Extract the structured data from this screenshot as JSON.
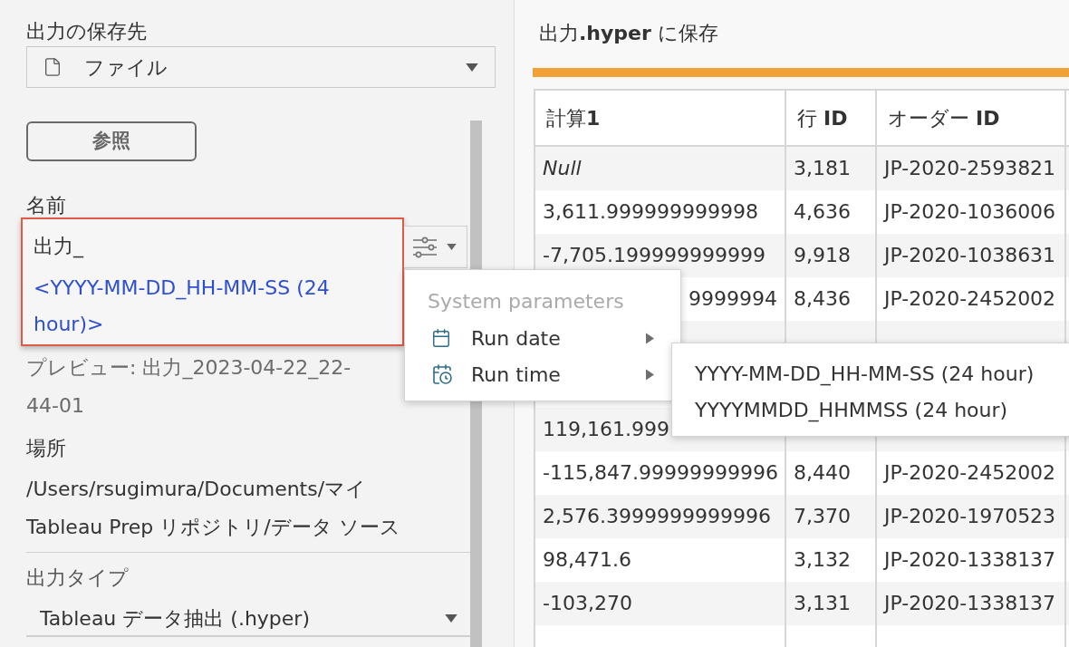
{
  "output_settings": {
    "destination_label": "出力の保存先",
    "destination": {
      "value": "ファイル"
    },
    "browse_button": "参照",
    "name_label": "名前",
    "name_field": {
      "text": "出力_",
      "token": "<YYYY-MM-DD_HH-MM-SS (24 hour)>",
      "highlighted": true
    },
    "preview": "プレビュー: 出力_2023-04-22_22-44-01",
    "location_label": "場所",
    "location": "/Users/rsugimura/Documents/マイ Tableau Prep リポジトリ/データ ソース",
    "output_type_label": "出力タイプ",
    "output_type": {
      "value": "Tableau データ抽出 (.hyper)"
    }
  },
  "parameter_menu": {
    "heading": "System parameters",
    "items": [
      {
        "label": "Run date",
        "kind": "date"
      },
      {
        "label": "Run time",
        "kind": "time"
      }
    ]
  },
  "run_time_submenu": {
    "items": [
      "YYYY-MM-DD_HH-MM-SS (24 hour)",
      "YYYYMMDD_HHMMSS (24 hour)"
    ]
  },
  "preview_pane": {
    "title": "出力**.hyper** に保存",
    "table": {
      "columns": [
        "計算**1**",
        "行 **ID**",
        "オーダー **ID**"
      ],
      "rows": [
        {
          "calc": {
            "text": "Null",
            "is_null": true
          },
          "row_id": "3,181",
          "order_id": "JP-2020-2593821"
        },
        {
          "calc": {
            "text": "3,611.999999999998",
            "is_null": false
          },
          "row_id": "4,636",
          "order_id": "JP-2020-1036006"
        },
        {
          "calc": {
            "text": "-7,705.199999999999",
            "is_null": false
          },
          "row_id": "9,918",
          "order_id": "JP-2020-1038631"
        },
        {
          "calc_tail": "9999994",
          "row_id": "8,436",
          "order_id": "JP-2020-2452002"
        },
        {},
        {},
        {
          "calc": {
            "text": "119,161.999",
            "is_null": false
          }
        },
        {
          "calc": {
            "text": "-115,847.99999999996",
            "is_null": false
          },
          "row_id": "8,440",
          "order_id": "JP-2020-2452002"
        },
        {
          "calc": {
            "text": "2,576.3999999999996",
            "is_null": false
          },
          "row_id": "7,370",
          "order_id": "JP-2020-1970523"
        },
        {
          "calc": {
            "text": "98,471.6",
            "is_null": false
          },
          "row_id": "3,132",
          "order_id": "JP-2020-1338137"
        },
        {
          "calc": {
            "text": "-103,270",
            "is_null": false
          },
          "row_id": "3,131",
          "order_id": "JP-2020-1338137"
        },
        {}
      ]
    }
  }
}
